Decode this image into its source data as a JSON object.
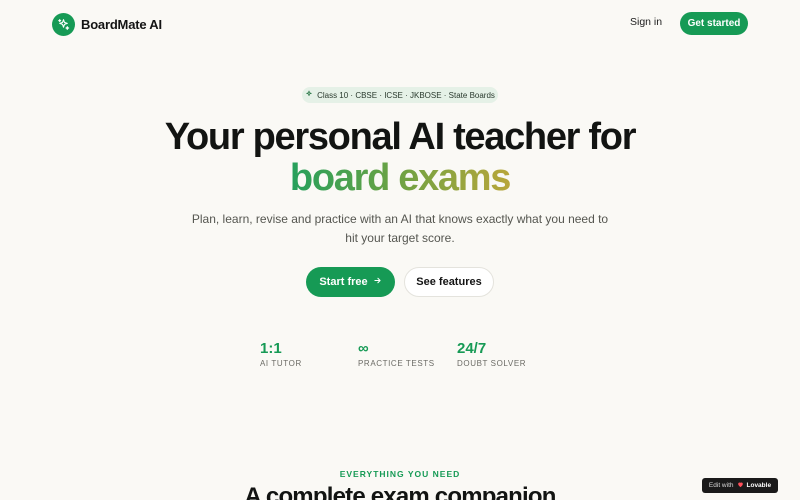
{
  "header": {
    "brand_name": "BoardMate AI",
    "signin_label": "Sign in",
    "get_started_label": "Get started"
  },
  "badge": {
    "icon": "sparkle-icon",
    "text": "Class 10 · CBSE · ICSE · JKBOSE · State Boards"
  },
  "hero": {
    "title_line1": "Your personal AI teacher for",
    "title_line2": "board exams",
    "subtitle": "Plan, learn, revise and practice with an AI that knows exactly what you need to hit your target score.",
    "primary_cta": "Start free",
    "primary_cta_icon": "arrow-right-icon",
    "secondary_cta": "See features"
  },
  "stats": [
    {
      "value": "1:1",
      "label": "AI TUTOR"
    },
    {
      "value": "∞",
      "label": "PRACTICE TESTS"
    },
    {
      "value": "24/7",
      "label": "DOUBT SOLVER"
    }
  ],
  "section": {
    "eyebrow": "EVERYTHING YOU NEED",
    "title": "A complete exam companion"
  },
  "lovable_badge": {
    "prefix": "Edit with",
    "icon": "heart-icon",
    "name": "Lovable"
  },
  "colors": {
    "accent": "#169a55",
    "background": "#faf9f5",
    "gradient_start": "#25a05c",
    "gradient_end": "#b8a63a"
  }
}
